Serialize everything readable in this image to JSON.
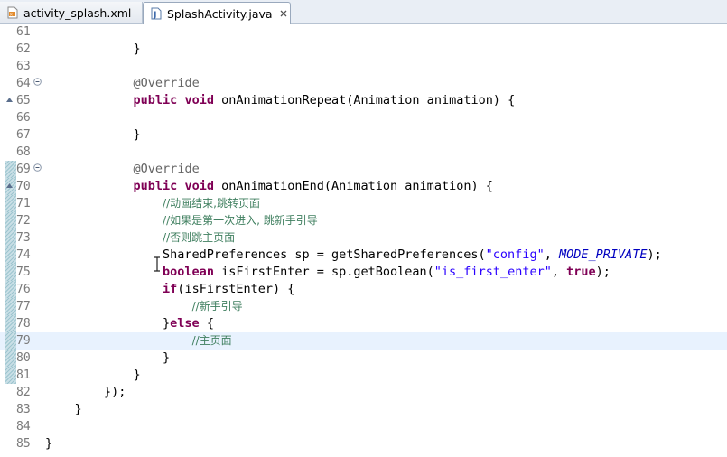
{
  "tabs": [
    {
      "label": "activity_splash.xml",
      "icon": "xml-file-icon",
      "active": false
    },
    {
      "label": "SplashActivity.java",
      "icon": "java-file-icon",
      "active": true
    }
  ],
  "editor": {
    "current_line": "79",
    "lines": [
      {
        "num": "61",
        "code": ""
      },
      {
        "num": "62",
        "code": "            }"
      },
      {
        "num": "63",
        "code": ""
      },
      {
        "num": "64",
        "code": "            @Override"
      },
      {
        "num": "65",
        "code": "            public void onAnimationRepeat(Animation animation) {"
      },
      {
        "num": "66",
        "code": ""
      },
      {
        "num": "67",
        "code": "            }"
      },
      {
        "num": "68",
        "code": ""
      },
      {
        "num": "69",
        "code": "            @Override"
      },
      {
        "num": "70",
        "code": "            public void onAnimationEnd(Animation animation) {"
      },
      {
        "num": "71",
        "code": "                //动画结束,跳转页面"
      },
      {
        "num": "72",
        "code": "                //如果是第一次进入, 跳新手引导"
      },
      {
        "num": "73",
        "code": "                //否则跳主页面"
      },
      {
        "num": "74",
        "code": "                SharedPreferences sp = getSharedPreferences(\"config\", MODE_PRIVATE);"
      },
      {
        "num": "75",
        "code": "                boolean isFirstEnter = sp.getBoolean(\"is_first_enter\", true);"
      },
      {
        "num": "76",
        "code": "                if(isFirstEnter) {"
      },
      {
        "num": "77",
        "code": "                    //新手引导"
      },
      {
        "num": "78",
        "code": "                }else {"
      },
      {
        "num": "79",
        "code": "                    //主页面"
      },
      {
        "num": "80",
        "code": "                }"
      },
      {
        "num": "81",
        "code": "            }"
      },
      {
        "num": "82",
        "code": "        });"
      },
      {
        "num": "83",
        "code": "    }"
      },
      {
        "num": "84",
        "code": ""
      },
      {
        "num": "85",
        "code": "}"
      }
    ],
    "changed_lines": [
      "69",
      "70",
      "71",
      "72",
      "73",
      "74",
      "75",
      "76",
      "77",
      "78",
      "79",
      "80",
      "81"
    ],
    "fold_lines": [
      "64",
      "69"
    ],
    "override_marker_lines": [
      "65",
      "70"
    ]
  },
  "colors": {
    "keyword": "#7f0055",
    "annotation": "#646464",
    "comment": "#3f7f5f",
    "string": "#2a00ff",
    "constant": "#0000c0",
    "current_line_bg": "#e8f2fe"
  }
}
